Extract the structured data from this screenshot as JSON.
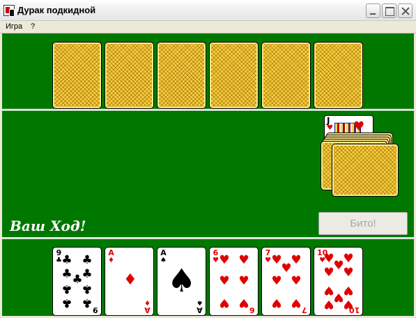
{
  "window": {
    "title": "Дурак подкидной"
  },
  "menu": {
    "items": [
      "Игра",
      "?"
    ]
  },
  "table": {
    "colors": {
      "felt": "#007800",
      "divider": "#d7e6d7",
      "card_back": "#f4cf3c"
    },
    "status_text": "Ваш Ход!",
    "bito_label": "Бито!",
    "bito_enabled": false
  },
  "opponent": {
    "cards_face_down": 6
  },
  "deck": {
    "trump_card": {
      "rank": "J",
      "suit": "hearts",
      "suit_symbol": "♥"
    }
  },
  "hand": [
    {
      "rank": "9",
      "suit": "clubs",
      "symbol": "♣",
      "color": "black"
    },
    {
      "rank": "A",
      "suit": "diamonds",
      "symbol": "♦",
      "color": "red"
    },
    {
      "rank": "A",
      "suit": "spades",
      "symbol": "♠",
      "color": "black"
    },
    {
      "rank": "6",
      "suit": "hearts",
      "symbol": "♥",
      "color": "red"
    },
    {
      "rank": "7",
      "suit": "hearts",
      "symbol": "♥",
      "color": "red"
    },
    {
      "rank": "10",
      "suit": "hearts",
      "symbol": "♥",
      "color": "red"
    }
  ]
}
